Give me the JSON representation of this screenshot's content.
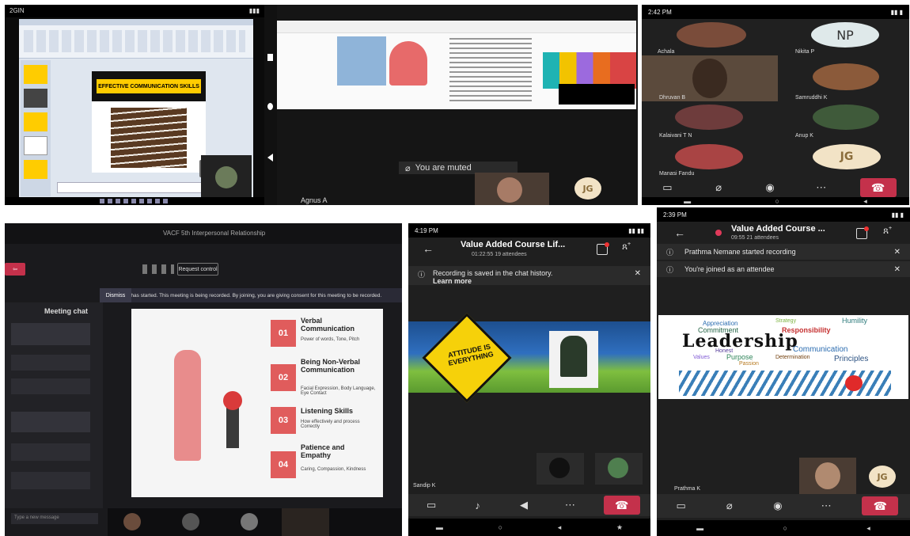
{
  "panel1": {
    "status_time": "2GIN",
    "slide_title": "EFFECTIVE COMMUNICATION SKILLS"
  },
  "panel2": {
    "muted_text": "You are muted",
    "name_label": "Agnus A",
    "avatar_initials": "JG"
  },
  "panel3": {
    "status_time": "2:42 PM",
    "tiles": [
      {
        "name": "Achala"
      },
      {
        "name": "Nikita P",
        "initials": "NP"
      },
      {
        "name": "Dhruvan B"
      },
      {
        "name": "Samruddhi K"
      },
      {
        "name": "Kalaivani T N"
      },
      {
        "name": "Anup K"
      },
      {
        "name": "Manasi Fandu"
      },
      {
        "name": "",
        "initials": "JG"
      }
    ]
  },
  "panel4": {
    "window_title": "VACF 5th Interpersonal Relationship",
    "button_label": "Request control",
    "recording_banner": "Recording has started. This meeting is being recorded. By joining, you are giving consent for this meeting to be recorded.",
    "dismiss_label": "Dismiss",
    "chat_title": "Meeting chat",
    "chat_placeholder": "Type a new message",
    "slide_items": [
      {
        "num": "01",
        "title": "Verbal Communication",
        "desc": "Power of words, Tone, Pitch"
      },
      {
        "num": "02",
        "title": "Being Non-Verbal Communication",
        "desc": "Facial Expression, Body Language, Eye Contact"
      },
      {
        "num": "03",
        "title": "Listening Skills",
        "desc": "How effectively and process Correctly"
      },
      {
        "num": "04",
        "title": "Patience and Empathy",
        "desc": "Caring, Compassion, Kindness"
      }
    ]
  },
  "panel5": {
    "status_time": "4:19 PM",
    "meeting_title": "Value Added Course Lif...",
    "meeting_sub": "01:22:55  19 attendees",
    "banner_text": "Recording is saved in the chat history.",
    "banner_link": "Learn more",
    "sign_text": "ATTITUDE IS EVERYTHING",
    "speaker_name": "Sandip K"
  },
  "panel6": {
    "status_time": "2:39 PM",
    "meeting_title": "Value Added Course ...",
    "meeting_sub": "09:55  21 attendees",
    "banner1": "Prathma Nemane started recording",
    "banner2": "You're joined as an attendee",
    "cloud_main": "Leadership",
    "cloud_words": [
      "Appreciation",
      "Strategy",
      "Humility",
      "Commitment",
      "Responsibility",
      "Honest",
      "Communication",
      "Values",
      "Purpose",
      "Determination",
      "Principles",
      "Passion"
    ],
    "speaker_name": "Prathma K",
    "avatar_initials": "JG"
  }
}
